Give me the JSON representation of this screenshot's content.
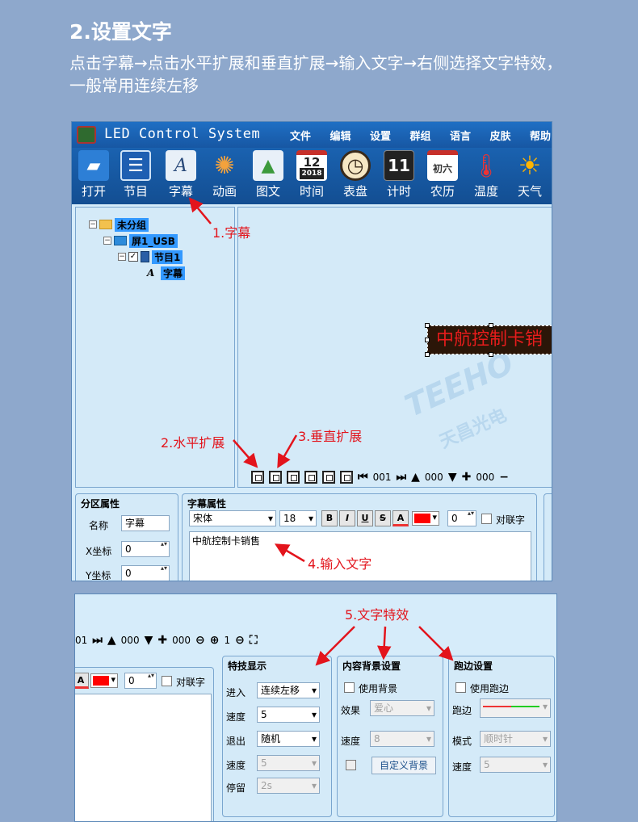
{
  "page": {
    "heading": "2.设置文字",
    "intro": "点击字幕→点击水平扩展和垂直扩展→输入文字→右侧选择文字特效，一般常用连续左移"
  },
  "app": {
    "title": "LED Control System",
    "menu": [
      "文件",
      "编辑",
      "设置",
      "群组",
      "语言",
      "皮肤",
      "帮助"
    ]
  },
  "toolbar": [
    {
      "label": "打开",
      "icon": "folder-open-icon",
      "glyph": "📂"
    },
    {
      "label": "节目",
      "icon": "program-icon",
      "glyph": "☰"
    },
    {
      "label": "字幕",
      "icon": "subtitle-text-icon",
      "glyph": "A"
    },
    {
      "label": "动画",
      "icon": "animation-icon",
      "glyph": "✺"
    },
    {
      "label": "图文",
      "icon": "image-text-icon",
      "glyph": "▲"
    },
    {
      "label": "时间",
      "icon": "calendar-clock-icon",
      "glyph": "12",
      "sub": "2018"
    },
    {
      "label": "表盘",
      "icon": "dial-clock-icon",
      "glyph": "◷"
    },
    {
      "label": "计时",
      "icon": "timer-icon",
      "glyph": "11"
    },
    {
      "label": "农历",
      "icon": "lunar-calendar-icon",
      "glyph": "初六"
    },
    {
      "label": "温度",
      "icon": "thermometer-icon",
      "glyph": "🌡"
    },
    {
      "label": "天气",
      "icon": "weather-sun-icon",
      "glyph": "☀"
    }
  ],
  "tree": {
    "group": "未分组",
    "screen": "屏1_USB",
    "program": "节目1",
    "item": "字幕"
  },
  "led_text": "中航控制卡销",
  "watermark": {
    "brand": "TEEHO",
    "sub": "天昌光电"
  },
  "strip1": {
    "frame": "001",
    "spacing": "000",
    "plus_value": "000"
  },
  "strip2": {
    "partial_frame": "01",
    "spacing": "000",
    "plus_value": "000",
    "zoom": "1"
  },
  "area_props": {
    "title": "分区属性",
    "name_label": "名称",
    "name_value": "字幕",
    "x_label": "X坐标",
    "x_value": "0",
    "y_label": "Y坐标",
    "y_value": "0"
  },
  "text_props": {
    "title": "字幕属性",
    "font": "宋体",
    "size": "18",
    "bold": "B",
    "italic": "I",
    "underline": "U",
    "strike": "S",
    "color_btn": "A",
    "spacing": "0",
    "couplet_label": "对联字",
    "content": "中航控制卡销售"
  },
  "effects": {
    "title": "特技显示",
    "enter_label": "进入",
    "enter_value": "连续左移",
    "speed_label": "速度",
    "speed_value": "5",
    "exit_label": "退出",
    "exit_value": "随机",
    "speed2_label": "速度",
    "speed2_value": "5",
    "stay_label": "停留",
    "stay_value": "2s"
  },
  "background": {
    "title": "内容背景设置",
    "use_label": "使用背景",
    "effect_label": "效果",
    "effect_value": "爱心",
    "speed_label": "速度",
    "speed_value": "8",
    "custom_button": "自定义背景"
  },
  "border": {
    "title": "跑边设置",
    "use_label": "使用跑边",
    "border_label": "跑边",
    "mode_label": "模式",
    "mode_value": "顺时针",
    "speed_label": "速度",
    "speed_value": "5"
  },
  "annotations": {
    "a1": "1.字幕",
    "a2": "2.水平扩展",
    "a3": "3.垂直扩展",
    "a4": "4.输入文字",
    "a5": "5.文字特效"
  },
  "colors": {
    "accent_red": "#e3141c",
    "titlebar": "#1757a3",
    "panel": "#d4eaf8",
    "text_color": "#ff0000"
  }
}
